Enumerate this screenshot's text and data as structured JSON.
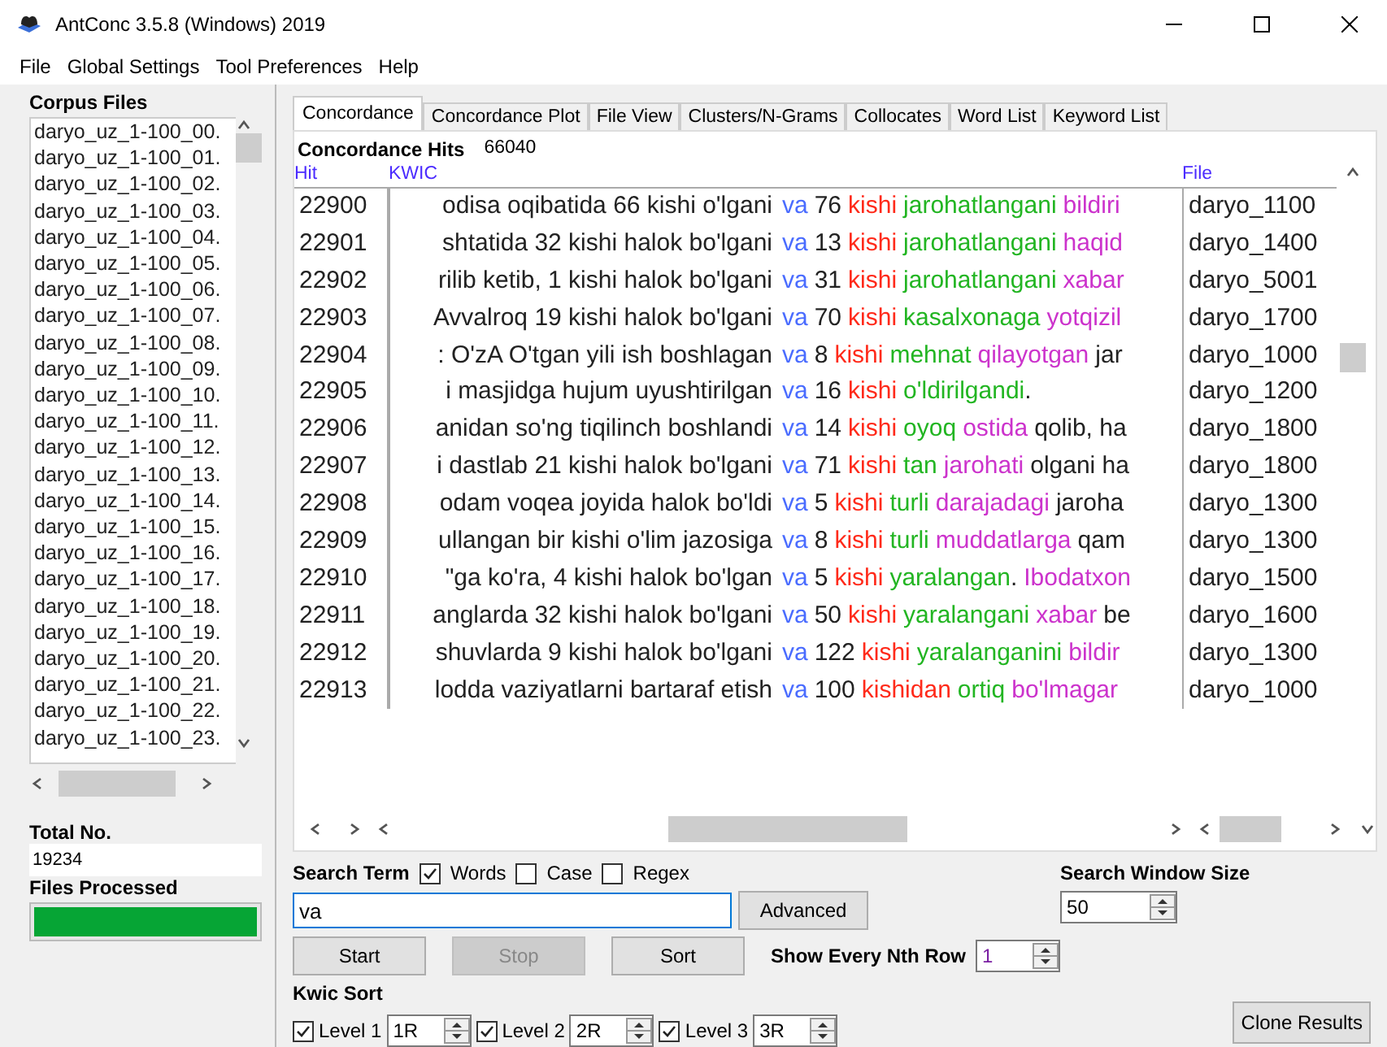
{
  "window": {
    "title": "AntConc 3.5.8 (Windows) 2019"
  },
  "menu": [
    "File",
    "Global Settings",
    "Tool Preferences",
    "Help"
  ],
  "corpus": {
    "heading": "Corpus Files",
    "files": [
      "daryo_uz_1-100_00.",
      "daryo_uz_1-100_01.",
      "daryo_uz_1-100_02.",
      "daryo_uz_1-100_03.",
      "daryo_uz_1-100_04.",
      "daryo_uz_1-100_05.",
      "daryo_uz_1-100_06.",
      "daryo_uz_1-100_07.",
      "daryo_uz_1-100_08.",
      "daryo_uz_1-100_09.",
      "daryo_uz_1-100_10.",
      "daryo_uz_1-100_11.",
      "daryo_uz_1-100_12.",
      "daryo_uz_1-100_13.",
      "daryo_uz_1-100_14.",
      "daryo_uz_1-100_15.",
      "daryo_uz_1-100_16.",
      "daryo_uz_1-100_17.",
      "daryo_uz_1-100_18.",
      "daryo_uz_1-100_19.",
      "daryo_uz_1-100_20.",
      "daryo_uz_1-100_21.",
      "daryo_uz_1-100_22.",
      "daryo_uz_1-100_23."
    ],
    "total_label": "Total No.",
    "total": "19234",
    "processed_label": "Files Processed",
    "processed": {
      "level": 1
    }
  },
  "tabs": [
    {
      "label": "Concordance",
      "selected": true
    },
    {
      "label": "Concordance Plot",
      "selected": false
    },
    {
      "label": "File View",
      "selected": false
    },
    {
      "label": "Clusters/N-Grams",
      "selected": false
    },
    {
      "label": "Collocates",
      "selected": false
    },
    {
      "label": "Word List",
      "selected": false
    },
    {
      "label": "Keyword List",
      "selected": false
    }
  ],
  "hits_label": "Concordance Hits",
  "hits": "66040",
  "table": {
    "columns": [
      "Hit",
      "KWIC",
      "File"
    ],
    "rows": [
      {
        "hit": "22900",
        "left": "odisa oqibatida 66 kishi o'lgani",
        "right": [
          {
            "kind": "key",
            "text": "va"
          },
          {
            "kind": "plain",
            "text": "76"
          },
          {
            "kind": "l1",
            "text": "kishi"
          },
          {
            "kind": "l2",
            "text": "jarohatlangani"
          },
          {
            "kind": "l3",
            "text": "bildiri"
          }
        ],
        "file": "daryo_1100"
      },
      {
        "hit": "22901",
        "left": "shtatida 32 kishi halok bo'lgani",
        "right": [
          {
            "kind": "key",
            "text": "va"
          },
          {
            "kind": "plain",
            "text": "13"
          },
          {
            "kind": "l1",
            "text": "kishi"
          },
          {
            "kind": "l2",
            "text": "jarohatlangani"
          },
          {
            "kind": "l3",
            "text": "haqid"
          }
        ],
        "file": "daryo_1400"
      },
      {
        "hit": "22902",
        "left": "rilib ketib, 1 kishi halok bo'lgani",
        "right": [
          {
            "kind": "key",
            "text": "va"
          },
          {
            "kind": "plain",
            "text": "31"
          },
          {
            "kind": "l1",
            "text": "kishi"
          },
          {
            "kind": "l2",
            "text": "jarohatlangani"
          },
          {
            "kind": "l3",
            "text": "xabar"
          }
        ],
        "file": "daryo_5001"
      },
      {
        "hit": "22903",
        "left": "Avvalroq 19 kishi halok bo'lgani",
        "right": [
          {
            "kind": "key",
            "text": "va"
          },
          {
            "kind": "plain",
            "text": "70"
          },
          {
            "kind": "l1",
            "text": "kishi"
          },
          {
            "kind": "l2",
            "text": "kasalxonaga"
          },
          {
            "kind": "l3",
            "text": "yotqizil"
          }
        ],
        "file": "daryo_1700"
      },
      {
        "hit": "22904",
        "left": ": O'zA O'tgan yili ish boshlagan",
        "right": [
          {
            "kind": "key",
            "text": "va"
          },
          {
            "kind": "plain",
            "text": "8"
          },
          {
            "kind": "l1",
            "text": "kishi"
          },
          {
            "kind": "l2",
            "text": "mehnat"
          },
          {
            "kind": "l3",
            "text": "qilayotgan"
          },
          {
            "kind": "plain",
            "text": "jar"
          }
        ],
        "file": "daryo_1000"
      },
      {
        "hit": "22905",
        "left": "i masjidga hujum uyushtirilgan",
        "right": [
          {
            "kind": "key",
            "text": "va"
          },
          {
            "kind": "plain",
            "text": "16"
          },
          {
            "kind": "l1",
            "text": "kishi"
          },
          {
            "kind": "l2",
            "text": "o'ldirilgandi"
          },
          {
            "kind": "tail",
            "text": "."
          }
        ],
        "file": "daryo_1200"
      },
      {
        "hit": "22906",
        "left": "anidan so'ng tiqilinch boshlandi",
        "right": [
          {
            "kind": "key",
            "text": "va"
          },
          {
            "kind": "plain",
            "text": "14"
          },
          {
            "kind": "l1",
            "text": "kishi"
          },
          {
            "kind": "l2",
            "text": "oyoq"
          },
          {
            "kind": "l3",
            "text": "ostida"
          },
          {
            "kind": "plain",
            "text": "qolib, ha"
          }
        ],
        "file": "daryo_1800"
      },
      {
        "hit": "22907",
        "left": "i dastlab 21 kishi halok bo'lgani",
        "right": [
          {
            "kind": "key",
            "text": "va"
          },
          {
            "kind": "plain",
            "text": "71"
          },
          {
            "kind": "l1",
            "text": "kishi"
          },
          {
            "kind": "l2",
            "text": "tan"
          },
          {
            "kind": "l3",
            "text": "jarohati"
          },
          {
            "kind": "plain",
            "text": "olgani ha"
          }
        ],
        "file": "daryo_1800"
      },
      {
        "hit": "22908",
        "left": "odam voqea joyida halok bo'ldi",
        "right": [
          {
            "kind": "key",
            "text": "va"
          },
          {
            "kind": "plain",
            "text": "5"
          },
          {
            "kind": "l1",
            "text": "kishi"
          },
          {
            "kind": "l2",
            "text": "turli"
          },
          {
            "kind": "l3",
            "text": "darajadagi"
          },
          {
            "kind": "plain",
            "text": "jaroha"
          }
        ],
        "file": "daryo_1300"
      },
      {
        "hit": "22909",
        "left": "ullangan bir kishi o'lim jazosiga",
        "right": [
          {
            "kind": "key",
            "text": "va"
          },
          {
            "kind": "plain",
            "text": "8"
          },
          {
            "kind": "l1",
            "text": "kishi"
          },
          {
            "kind": "l2",
            "text": "turli"
          },
          {
            "kind": "l3",
            "text": "muddatlarga"
          },
          {
            "kind": "plain",
            "text": "qam"
          }
        ],
        "file": "daryo_1300"
      },
      {
        "hit": "22910",
        "left": "\"ga ko'ra, 4 kishi halok bo'lgan",
        "right": [
          {
            "kind": "key",
            "text": "va"
          },
          {
            "kind": "plain",
            "text": "5"
          },
          {
            "kind": "l1",
            "text": "kishi"
          },
          {
            "kind": "l2",
            "text": "yaralangan"
          },
          {
            "kind": "tail",
            "text": "."
          },
          {
            "kind": "l3",
            "text": "Ibodatxon"
          }
        ],
        "file": "daryo_1500"
      },
      {
        "hit": "22911",
        "left": "anglarda 32 kishi halok bo'lgani",
        "right": [
          {
            "kind": "key",
            "text": "va"
          },
          {
            "kind": "plain",
            "text": "50"
          },
          {
            "kind": "l1",
            "text": "kishi"
          },
          {
            "kind": "l2",
            "text": "yaralangani"
          },
          {
            "kind": "l3",
            "text": "xabar"
          },
          {
            "kind": "plain",
            "text": "be"
          }
        ],
        "file": "daryo_1600"
      },
      {
        "hit": "22912",
        "left": "shuvlarda 9 kishi halok bo'lgani",
        "right": [
          {
            "kind": "key",
            "text": "va"
          },
          {
            "kind": "plain",
            "text": "122"
          },
          {
            "kind": "l1",
            "text": "kishi"
          },
          {
            "kind": "l2",
            "text": "yaralanganini"
          },
          {
            "kind": "l3",
            "text": "bildir"
          }
        ],
        "file": "daryo_1300"
      },
      {
        "hit": "22913",
        "left": "lodda vaziyatlarni bartaraf etish",
        "right": [
          {
            "kind": "key",
            "text": "va"
          },
          {
            "kind": "plain",
            "text": "100"
          },
          {
            "kind": "l1",
            "text": "kishidan"
          },
          {
            "kind": "l2",
            "text": "ortiq"
          },
          {
            "kind": "l3",
            "text": "bo'lmagar"
          }
        ],
        "file": "daryo_1000"
      }
    ]
  },
  "search": {
    "label": "Search Term",
    "options": [
      {
        "label": "Words",
        "checked": true
      },
      {
        "label": "Case",
        "checked": false
      },
      {
        "label": "Regex",
        "checked": false
      }
    ],
    "value": "va",
    "advanced": "Advanced",
    "window_label": "Search Window Size",
    "window_size": "50"
  },
  "buttons": [
    {
      "label": "Start",
      "disabled": false
    },
    {
      "label": "Stop",
      "disabled": true
    },
    {
      "label": "Sort",
      "disabled": false
    }
  ],
  "nth_label": "Show Every Nth Row",
  "nth": "1",
  "kwic_sort": {
    "label": "Kwic Sort",
    "levels": [
      {
        "label": "Level 1",
        "checked": true,
        "value": "1R"
      },
      {
        "label": "Level 2",
        "checked": true,
        "value": "2R"
      },
      {
        "label": "Level 3",
        "checked": true,
        "value": "3R"
      }
    ]
  },
  "clone": "Clone Results"
}
